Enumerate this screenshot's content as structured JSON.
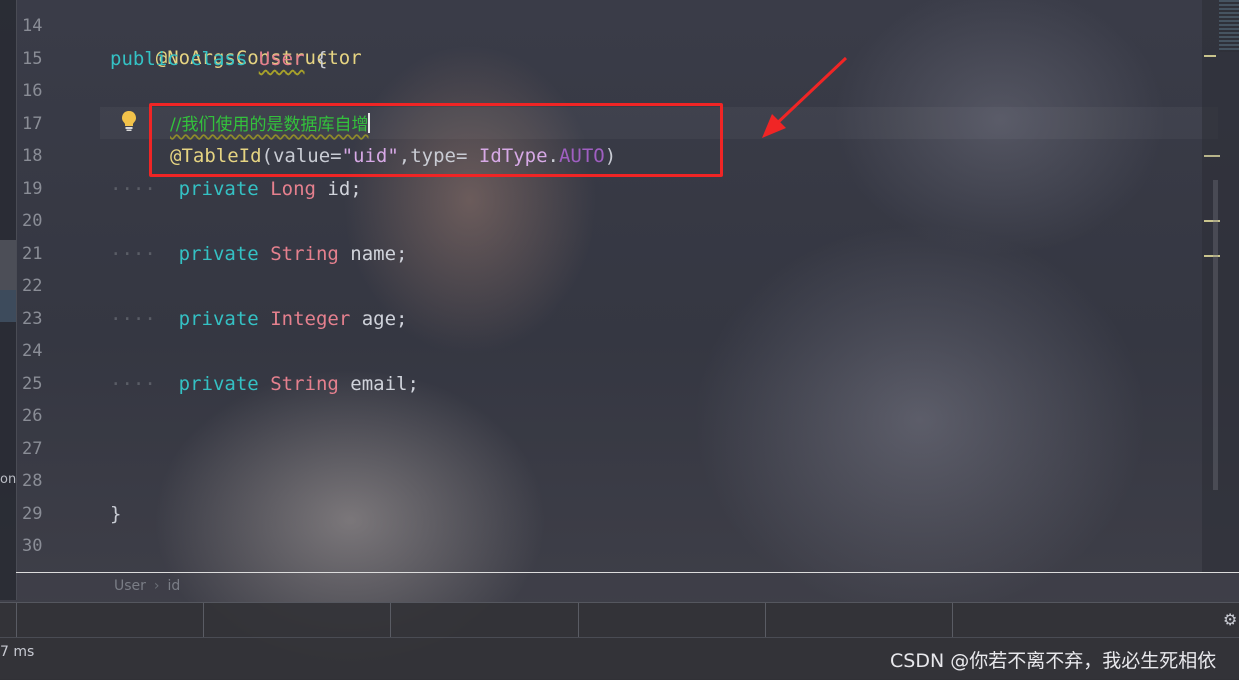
{
  "editor": {
    "line_numbers": [
      "14",
      "15",
      "16",
      "17",
      "18",
      "19",
      "20",
      "21",
      "22",
      "23",
      "24",
      "25",
      "26",
      "27",
      "28",
      "29",
      "30"
    ],
    "lines": {
      "l14": {
        "annotation": "@NoArgsConstructor"
      },
      "l15": {
        "kw1": "public",
        "kw2": "class",
        "classname": "User",
        "brace": " {"
      },
      "l17": {
        "comment": "//我们使用的是数据库自增"
      },
      "l18": {
        "annotation": "@TableId",
        "p1": "(value=",
        "str": "\"uid\"",
        "p2": ",type= ",
        "type": "IdType",
        "dot": ".",
        "enumval": "AUTO",
        "close": ")"
      },
      "l19": {
        "kw": "private",
        "type": "Long",
        "name": "id;"
      },
      "l21": {
        "kw": "private",
        "type": "String",
        "name": "name;"
      },
      "l23": {
        "kw": "private",
        "type": "Integer",
        "name": "age;"
      },
      "l25": {
        "kw": "private",
        "type": "String",
        "name": "email;"
      },
      "l29": {
        "brace": "}"
      }
    },
    "indent_dots": "····"
  },
  "breadcrumb": {
    "class": "User",
    "separator": "›",
    "field": "id"
  },
  "left_strip": {
    "label": "on"
  },
  "status": {
    "time_text": "7 ms"
  },
  "watermark": "CSDN @你若不离不弃，我必生死相依",
  "colors": {
    "highlight_box": "#f02525",
    "keyword": "#34c1c4",
    "type": "#e5808e",
    "annotation": "#e6d482",
    "comment": "#33c13c"
  },
  "icons": {
    "bulb": "lightbulb-icon",
    "gear": "gear-icon",
    "arrow": "red-arrow-annotation"
  }
}
